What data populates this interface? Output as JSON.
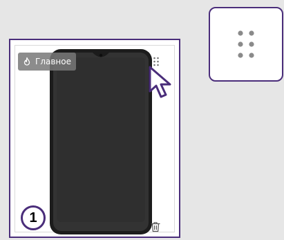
{
  "card": {
    "badge": {
      "label": "Главное",
      "icon": "flame-icon"
    },
    "drag_handle_icon": "drag-handle-icon",
    "delete_icon": "trash-icon",
    "image": "phone-image"
  },
  "annotation": {
    "step_number": "1"
  },
  "zoom": {
    "icon": "drag-handle-icon"
  },
  "colors": {
    "accent": "#4a2d7a",
    "badge_bg": "#787878",
    "background": "#e6e6e6",
    "phone_body": "#2b2b2b"
  }
}
